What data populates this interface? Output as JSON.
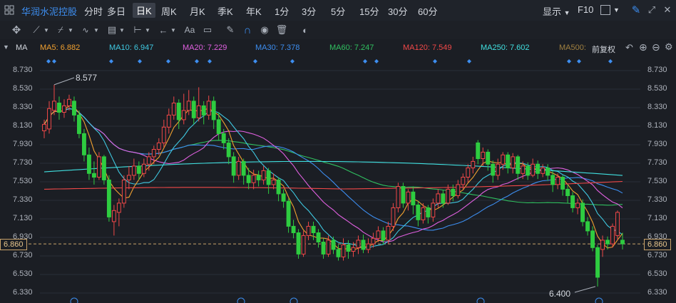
{
  "toolbar": {
    "stock_name": "华润水泥控股",
    "periods": [
      "分时",
      "多日",
      "日K",
      "周K",
      "月K",
      "季K",
      "年K",
      "1分",
      "3分",
      "5分",
      "15分",
      "30分",
      "60分"
    ],
    "selected_period": "日K",
    "display_label": "显示",
    "f10_label": "F10"
  },
  "drawing_tools": {
    "font_label": "Aa"
  },
  "indicator": {
    "name": "MA",
    "ma5": "MA5: 6.882",
    "ma10": "MA10: 6.947",
    "ma20": "MA20: 7.229",
    "ma30": "MA30: 7.378",
    "ma60": "MA60: 7.247",
    "ma120": "MA120: 7.549",
    "ma250": "MA250: 7.602",
    "ma500": "MA500:",
    "adjust": "前复权",
    "colors": {
      "ma5": "#f0a030",
      "ma10": "#3fc8e0",
      "ma20": "#e060e0",
      "ma30": "#3d8ef0",
      "ma60": "#30c060",
      "ma120": "#f04848",
      "ma250": "#40e0e0",
      "ma500": "#a08040"
    }
  },
  "price_axis": {
    "labels": [
      "8.730",
      "8.530",
      "8.330",
      "8.130",
      "7.930",
      "7.730",
      "7.530",
      "7.330",
      "7.130",
      "6.930",
      "6.730",
      "6.530",
      "6.330"
    ],
    "current_price": "6.860"
  },
  "annotations": {
    "high": "8.577",
    "low": "6.400"
  },
  "chart_data": {
    "type": "candlestick",
    "ylim": [
      6.33,
      8.73
    ],
    "up_color": "#f04848",
    "down_color": "#2ecc40",
    "candles": [
      {
        "o": 8.08,
        "c": 8.15,
        "h": 8.2,
        "l": 8.0
      },
      {
        "o": 8.1,
        "c": 8.32,
        "h": 8.4,
        "l": 8.05
      },
      {
        "o": 8.3,
        "c": 8.4,
        "h": 8.577,
        "l": 8.25
      },
      {
        "o": 8.38,
        "c": 8.28,
        "h": 8.45,
        "l": 8.2
      },
      {
        "o": 8.28,
        "c": 8.35,
        "h": 8.42,
        "l": 8.22
      },
      {
        "o": 8.35,
        "c": 8.42,
        "h": 8.47,
        "l": 8.3
      },
      {
        "o": 8.4,
        "c": 8.25,
        "h": 8.45,
        "l": 8.18
      },
      {
        "o": 8.25,
        "c": 8.05,
        "h": 8.3,
        "l": 8.0
      },
      {
        "o": 8.05,
        "c": 7.82,
        "h": 8.1,
        "l": 7.75
      },
      {
        "o": 7.82,
        "c": 7.62,
        "h": 7.9,
        "l": 7.55
      },
      {
        "o": 7.62,
        "c": 7.58,
        "h": 7.75,
        "l": 7.5
      },
      {
        "o": 7.58,
        "c": 7.8,
        "h": 7.85,
        "l": 7.55
      },
      {
        "o": 7.8,
        "c": 7.55,
        "h": 7.82,
        "l": 7.5
      },
      {
        "o": 7.55,
        "c": 7.15,
        "h": 7.6,
        "l": 7.1
      },
      {
        "o": 7.1,
        "c": 7.22,
        "h": 7.28,
        "l": 6.95
      },
      {
        "o": 7.2,
        "c": 7.3,
        "h": 7.35,
        "l": 7.05
      },
      {
        "o": 7.3,
        "c": 7.55,
        "h": 7.6,
        "l": 7.25
      },
      {
        "o": 7.55,
        "c": 7.6,
        "h": 7.7,
        "l": 7.45
      },
      {
        "o": 7.6,
        "c": 7.7,
        "h": 7.78,
        "l": 7.55
      },
      {
        "o": 7.7,
        "c": 7.62,
        "h": 7.75,
        "l": 7.55
      },
      {
        "o": 7.62,
        "c": 7.72,
        "h": 7.78,
        "l": 7.58
      },
      {
        "o": 7.72,
        "c": 7.8,
        "h": 7.85,
        "l": 7.65
      },
      {
        "o": 7.8,
        "c": 7.88,
        "h": 7.92,
        "l": 7.72
      },
      {
        "o": 7.88,
        "c": 7.95,
        "h": 8.0,
        "l": 7.82
      },
      {
        "o": 7.95,
        "c": 8.12,
        "h": 8.2,
        "l": 7.9
      },
      {
        "o": 8.12,
        "c": 8.25,
        "h": 8.32,
        "l": 8.05
      },
      {
        "o": 8.25,
        "c": 8.38,
        "h": 8.45,
        "l": 8.2
      },
      {
        "o": 8.38,
        "c": 8.2,
        "h": 8.42,
        "l": 8.1
      },
      {
        "o": 8.2,
        "c": 8.3,
        "h": 8.48,
        "l": 8.15
      },
      {
        "o": 8.3,
        "c": 8.4,
        "h": 8.52,
        "l": 8.25
      },
      {
        "o": 8.4,
        "c": 8.22,
        "h": 8.45,
        "l": 8.15
      },
      {
        "o": 8.22,
        "c": 8.35,
        "h": 8.55,
        "l": 8.18
      },
      {
        "o": 8.35,
        "c": 8.25,
        "h": 8.4,
        "l": 8.15
      },
      {
        "o": 8.25,
        "c": 8.4,
        "h": 8.46,
        "l": 8.2
      },
      {
        "o": 8.4,
        "c": 8.2,
        "h": 8.45,
        "l": 8.1
      },
      {
        "o": 8.2,
        "c": 8.05,
        "h": 8.28,
        "l": 7.98
      },
      {
        "o": 8.05,
        "c": 7.95,
        "h": 8.1,
        "l": 7.88
      },
      {
        "o": 7.95,
        "c": 7.8,
        "h": 8.0,
        "l": 7.72
      },
      {
        "o": 7.8,
        "c": 7.6,
        "h": 7.85,
        "l": 7.52
      },
      {
        "o": 7.6,
        "c": 7.75,
        "h": 7.8,
        "l": 7.55
      },
      {
        "o": 7.75,
        "c": 7.6,
        "h": 7.78,
        "l": 7.5
      },
      {
        "o": 7.6,
        "c": 7.52,
        "h": 7.68,
        "l": 7.45
      },
      {
        "o": 7.52,
        "c": 7.6,
        "h": 7.66,
        "l": 7.45
      },
      {
        "o": 7.6,
        "c": 7.55,
        "h": 7.65,
        "l": 7.48
      },
      {
        "o": 7.55,
        "c": 7.65,
        "h": 7.7,
        "l": 7.5
      },
      {
        "o": 7.65,
        "c": 7.5,
        "h": 7.68,
        "l": 7.4
      },
      {
        "o": 7.5,
        "c": 7.55,
        "h": 7.62,
        "l": 7.45
      },
      {
        "o": 7.55,
        "c": 7.4,
        "h": 7.58,
        "l": 7.32
      },
      {
        "o": 7.4,
        "c": 7.32,
        "h": 7.45,
        "l": 7.25
      },
      {
        "o": 7.32,
        "c": 7.05,
        "h": 7.35,
        "l": 6.98
      },
      {
        "o": 7.05,
        "c": 6.98,
        "h": 7.12,
        "l": 6.92
      },
      {
        "o": 6.98,
        "c": 6.75,
        "h": 7.02,
        "l": 6.7
      },
      {
        "o": 6.75,
        "c": 6.95,
        "h": 7.0,
        "l": 6.72
      },
      {
        "o": 6.95,
        "c": 7.05,
        "h": 7.1,
        "l": 6.9
      },
      {
        "o": 7.05,
        "c": 6.98,
        "h": 7.1,
        "l": 6.9
      },
      {
        "o": 6.98,
        "c": 6.88,
        "h": 7.02,
        "l": 6.82
      },
      {
        "o": 6.88,
        "c": 6.75,
        "h": 6.92,
        "l": 6.7
      },
      {
        "o": 6.75,
        "c": 6.9,
        "h": 6.95,
        "l": 6.72
      },
      {
        "o": 6.9,
        "c": 6.8,
        "h": 6.94,
        "l": 6.75
      },
      {
        "o": 6.8,
        "c": 6.72,
        "h": 6.85,
        "l": 6.68
      },
      {
        "o": 6.72,
        "c": 6.85,
        "h": 6.92,
        "l": 6.68
      },
      {
        "o": 6.85,
        "c": 6.78,
        "h": 6.9,
        "l": 6.7
      },
      {
        "o": 6.78,
        "c": 6.82,
        "h": 6.88,
        "l": 6.72
      },
      {
        "o": 6.82,
        "c": 6.9,
        "h": 6.95,
        "l": 6.75
      },
      {
        "o": 6.9,
        "c": 6.8,
        "h": 6.96,
        "l": 6.76
      },
      {
        "o": 6.8,
        "c": 6.86,
        "h": 6.92,
        "l": 6.76
      },
      {
        "o": 6.86,
        "c": 6.92,
        "h": 6.98,
        "l": 6.82
      },
      {
        "o": 6.92,
        "c": 7.0,
        "h": 7.05,
        "l": 6.88
      },
      {
        "o": 7.0,
        "c": 6.9,
        "h": 7.04,
        "l": 6.85
      },
      {
        "o": 6.9,
        "c": 7.05,
        "h": 7.1,
        "l": 6.86
      },
      {
        "o": 7.05,
        "c": 7.25,
        "h": 7.3,
        "l": 7.0
      },
      {
        "o": 7.25,
        "c": 7.48,
        "h": 7.52,
        "l": 7.2
      },
      {
        "o": 7.48,
        "c": 7.3,
        "h": 7.52,
        "l": 7.25
      },
      {
        "o": 7.3,
        "c": 7.42,
        "h": 7.45,
        "l": 7.22
      },
      {
        "o": 7.42,
        "c": 7.28,
        "h": 7.48,
        "l": 7.18
      },
      {
        "o": 7.28,
        "c": 7.12,
        "h": 7.32,
        "l": 7.05
      },
      {
        "o": 7.12,
        "c": 7.25,
        "h": 7.3,
        "l": 7.08
      },
      {
        "o": 7.25,
        "c": 7.15,
        "h": 7.28,
        "l": 7.08
      },
      {
        "o": 7.15,
        "c": 7.3,
        "h": 7.35,
        "l": 7.1
      },
      {
        "o": 7.3,
        "c": 7.4,
        "h": 7.45,
        "l": 7.25
      },
      {
        "o": 7.4,
        "c": 7.3,
        "h": 7.44,
        "l": 7.25
      },
      {
        "o": 7.3,
        "c": 7.45,
        "h": 7.5,
        "l": 7.28
      },
      {
        "o": 7.45,
        "c": 7.38,
        "h": 7.5,
        "l": 7.32
      },
      {
        "o": 7.38,
        "c": 7.5,
        "h": 7.55,
        "l": 7.35
      },
      {
        "o": 7.5,
        "c": 7.58,
        "h": 7.62,
        "l": 7.45
      },
      {
        "o": 7.58,
        "c": 7.68,
        "h": 7.72,
        "l": 7.52
      },
      {
        "o": 7.68,
        "c": 7.75,
        "h": 7.8,
        "l": 7.62
      },
      {
        "o": 7.95,
        "c": 7.78,
        "h": 7.98,
        "l": 7.72
      },
      {
        "o": 7.78,
        "c": 7.85,
        "h": 7.9,
        "l": 7.7
      },
      {
        "o": 7.85,
        "c": 7.72,
        "h": 7.88,
        "l": 7.65
      },
      {
        "o": 7.72,
        "c": 7.6,
        "h": 7.76,
        "l": 7.52
      },
      {
        "o": 7.6,
        "c": 7.72,
        "h": 7.78,
        "l": 7.55
      },
      {
        "o": 7.72,
        "c": 7.82,
        "h": 7.85,
        "l": 7.66
      },
      {
        "o": 7.82,
        "c": 7.68,
        "h": 7.85,
        "l": 7.62
      },
      {
        "o": 7.68,
        "c": 7.8,
        "h": 7.84,
        "l": 7.62
      },
      {
        "o": 7.8,
        "c": 7.62,
        "h": 7.82,
        "l": 7.55
      },
      {
        "o": 7.62,
        "c": 7.7,
        "h": 7.75,
        "l": 7.56
      },
      {
        "o": 7.7,
        "c": 7.6,
        "h": 7.74,
        "l": 7.55
      },
      {
        "o": 7.6,
        "c": 7.72,
        "h": 7.78,
        "l": 7.58
      },
      {
        "o": 7.72,
        "c": 7.62,
        "h": 7.76,
        "l": 7.56
      },
      {
        "o": 7.62,
        "c": 7.68,
        "h": 7.72,
        "l": 7.58
      },
      {
        "o": 7.68,
        "c": 7.6,
        "h": 7.72,
        "l": 7.54
      },
      {
        "o": 7.6,
        "c": 7.5,
        "h": 7.65,
        "l": 7.42
      },
      {
        "o": 7.5,
        "c": 7.58,
        "h": 7.62,
        "l": 7.45
      },
      {
        "o": 7.58,
        "c": 7.45,
        "h": 7.6,
        "l": 7.38
      },
      {
        "o": 7.45,
        "c": 7.38,
        "h": 7.5,
        "l": 7.3
      },
      {
        "o": 7.38,
        "c": 7.25,
        "h": 7.42,
        "l": 7.2
      },
      {
        "o": 7.25,
        "c": 7.3,
        "h": 7.35,
        "l": 7.18
      },
      {
        "o": 7.3,
        "c": 7.1,
        "h": 7.34,
        "l": 7.05
      },
      {
        "o": 7.1,
        "c": 7.0,
        "h": 7.15,
        "l": 6.95
      },
      {
        "o": 7.0,
        "c": 6.82,
        "h": 7.05,
        "l": 6.78
      },
      {
        "o": 6.82,
        "c": 6.5,
        "h": 6.85,
        "l": 6.4
      },
      {
        "o": 6.8,
        "c": 6.9,
        "h": 6.95,
        "l": 6.72
      },
      {
        "o": 6.9,
        "c": 6.86,
        "h": 6.94,
        "l": 6.8
      },
      {
        "o": 6.86,
        "c": 7.05,
        "h": 7.08,
        "l": 6.82
      },
      {
        "o": 6.95,
        "c": 7.2,
        "h": 7.22,
        "l": 6.9
      },
      {
        "o": 6.9,
        "c": 6.86,
        "h": 6.98,
        "l": 6.8
      }
    ]
  }
}
